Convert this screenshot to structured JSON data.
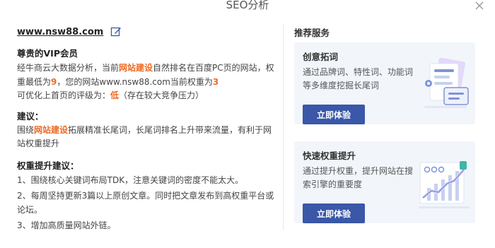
{
  "dialog": {
    "title": "SEO分析"
  },
  "left": {
    "site": "www.nsw88.com",
    "vip_heading": "尊贵的VIP会员",
    "analysis": {
      "p1": "经牛商云大数据分析，当前",
      "kw": "网站建设",
      "p2": "自然排名在百度PC页的网站，权重最低为",
      "min_weight": "9",
      "p3": "，您的网站www.nsw88.com当前权重为",
      "cur_weight": "3",
      "p4": "可优化上首页的评级为：",
      "rating": "低",
      "p5": "（存在较大竞争压力）"
    },
    "suggest_heading": "建议：",
    "suggest": {
      "p1": "围绕",
      "kw": "网站建设",
      "p2": "拓展精准长尾词，长尾词排名上升带来流量，有利于网站权重提升"
    },
    "weight_heading": "权重提升建议：",
    "weight_items": [
      "1、围绕核心关键词布局TDK，注意关键词的密度不能太大。",
      "2、每周坚持更新3篇以上原创文章。同时把文章发布到高权重平台或论坛。",
      "3、增加高质量网站外链。"
    ]
  },
  "right": {
    "heading": "推荐服务",
    "cards": [
      {
        "title": "创意拓词",
        "desc": "通过品牌词、特性词、功能词等多维度挖掘长尾词",
        "button": "立即体验"
      },
      {
        "title": "快速权重提升",
        "desc": "通过提升权重，提升网站在搜索引擎的重要度",
        "button": "立即体验"
      }
    ]
  },
  "colors": {
    "highlight": "#ee6a23",
    "button": "#3a57a8",
    "card_bg": "#f2f6fb"
  }
}
